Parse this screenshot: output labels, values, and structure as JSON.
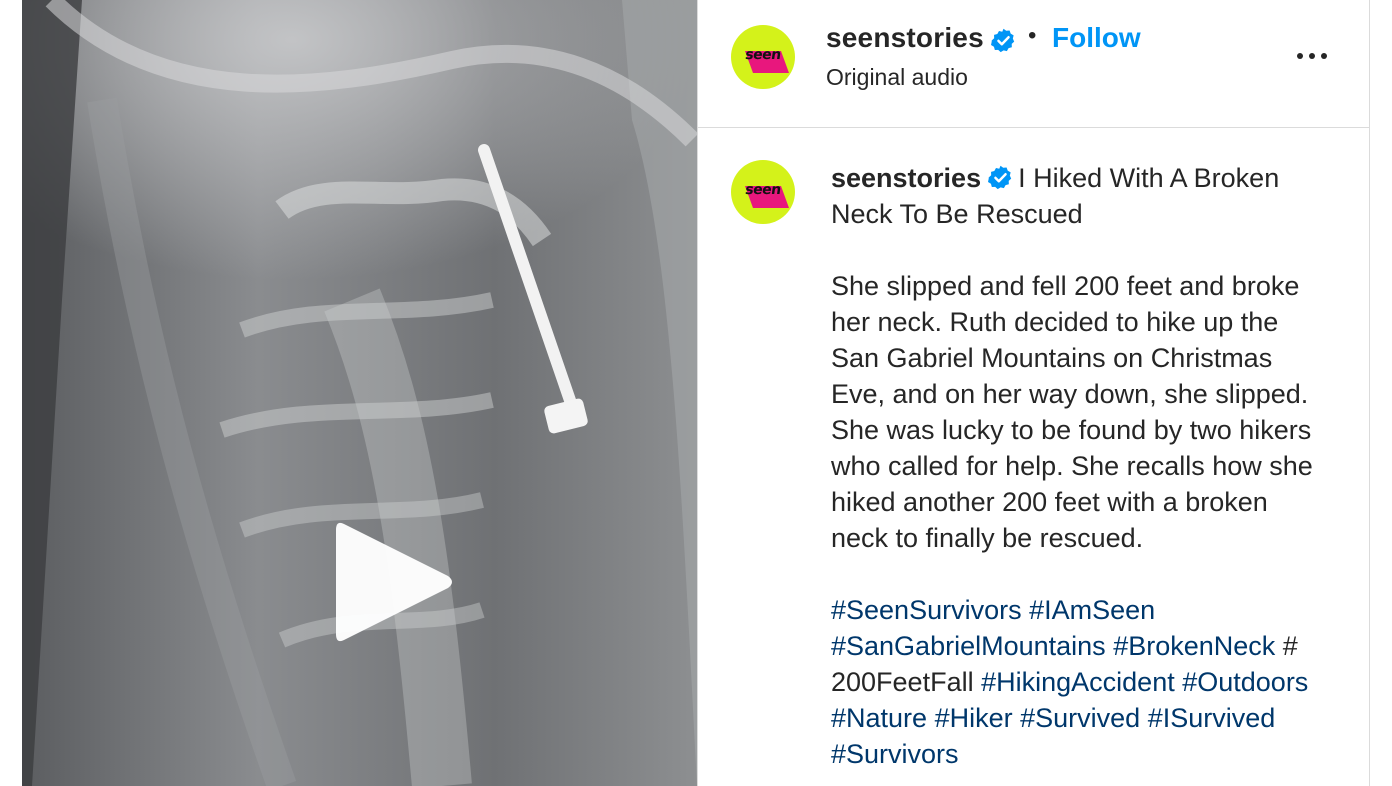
{
  "post": {
    "username": "seenstories",
    "follow_label": "Follow",
    "separator": "•",
    "audio_label": "Original audio",
    "avatar_text": "seen",
    "more_icon": "more-horizontal-icon",
    "verified_icon": "verified-badge-icon",
    "play_icon": "play-icon"
  },
  "caption": {
    "username": "seenstories",
    "title": "I Hiked With A Broken Neck To Be Rescued",
    "body": "She slipped and fell 200 feet and broke her neck. Ruth decided to hike up the San Gabriel Mountains on Christmas Eve, and on her way down, she slipped. She was lucky to be found by two hikers who called for help. She recalls how she hiked another 200 feet with a broken neck to finally be rescued.",
    "hashtags": {
      "seen_survivors": "#SeenSurvivors",
      "i_am_seen": "#IAmSeen",
      "san_gabriel": "#SanGabrielMountains",
      "broken_neck": "#BrokenNeck",
      "feet_fall_plain": "# 200FeetFall",
      "hiking_accident": "#HikingAccident",
      "outdoors": "#Outdoors",
      "nature": "#Nature",
      "hiker": "#Hiker",
      "survived": "#Survived",
      "i_survived": "#ISurvived",
      "survivors": "#Survivors"
    }
  },
  "colors": {
    "accent": "#0095f6",
    "hashtag": "#00376b",
    "text": "#262626",
    "avatar_bg": "#d4f21a",
    "avatar_shape": "#e8177d",
    "border": "#dbdbdb"
  }
}
